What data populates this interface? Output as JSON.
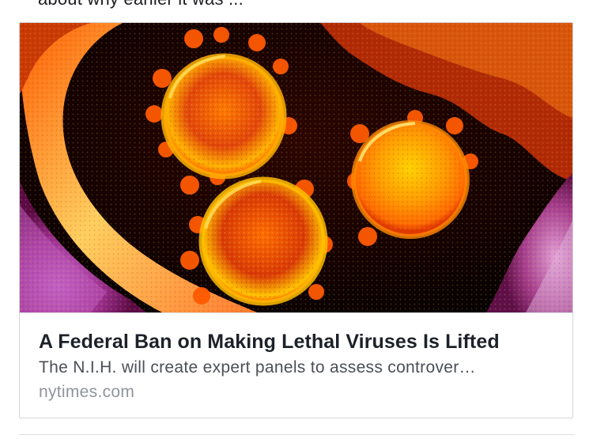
{
  "post": {
    "cut_off_text": "about why earlier it was ..."
  },
  "link_card": {
    "image_alt": "Microscope image of coronavirus particles",
    "headline": "A Federal Ban on Making Lethal Viruses Is Lifted",
    "description": "The N.I.H. will create expert panels to assess controver…",
    "domain": "nytimes.com"
  },
  "colors": {
    "headline": "#1d2129",
    "description": "#4b4f56",
    "domain": "#90949c",
    "card_border": "#d3d4d8"
  }
}
